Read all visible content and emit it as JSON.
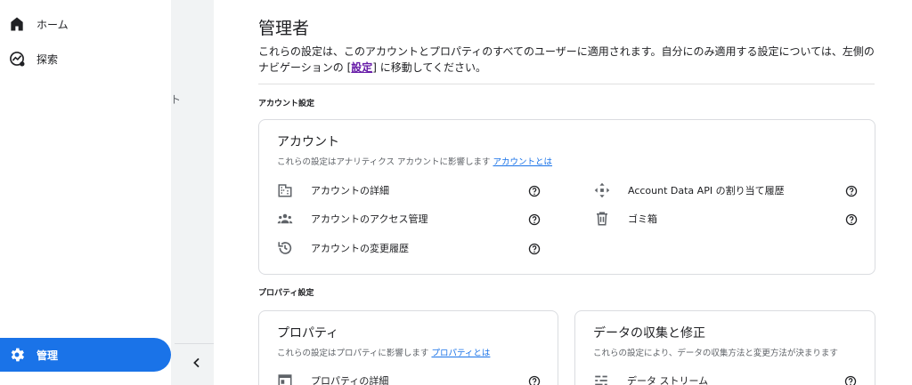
{
  "sidebar": {
    "items": [
      {
        "label": "ホーム",
        "icon": "home-icon"
      },
      {
        "label": "探索",
        "icon": "explore-icon"
      }
    ],
    "active_item": {
      "label": "管理",
      "icon": "gear-icon"
    }
  },
  "rail": {
    "glyph": "ト",
    "collapse_icon": "chevron-left-icon"
  },
  "header": {
    "title": "管理者",
    "desc_before": "これらの設定は、このアカウントとプロパティのすべてのユーザーに適用されます。自分にのみ適用する設定については、左側のナビゲーションの [",
    "desc_link": "設定",
    "desc_after": "] に移動してください。"
  },
  "sections": {
    "account_label": "アカウント設定",
    "property_label": "プロパティ設定"
  },
  "account_card": {
    "title": "アカウント",
    "subtitle": "これらの設定はアナリティクス アカウントに影響します",
    "link": "アカウントとは",
    "items": [
      {
        "label": "アカウントの詳細",
        "icon": "building-icon"
      },
      {
        "label": "アカウントのアクセス管理",
        "icon": "people-icon"
      },
      {
        "label": "アカウントの変更履歴",
        "icon": "history-icon"
      },
      {
        "label": "Account Data API の割り当て履歴",
        "icon": "move-arrows-icon"
      },
      {
        "label": "ゴミ箱",
        "icon": "trash-icon"
      }
    ]
  },
  "property_card": {
    "title": "プロパティ",
    "subtitle": "これらの設定はプロパティに影響します",
    "link": "プロパティとは",
    "items": [
      {
        "label": "プロパティの詳細",
        "icon": "browser-window-icon"
      }
    ]
  },
  "data_card": {
    "title": "データの収集と修正",
    "subtitle": "これらの設定により、データの収集方法と変更方法が決まります",
    "items": [
      {
        "label": "データ ストリーム",
        "icon": "stream-icon"
      }
    ]
  },
  "colors": {
    "accent": "#1a73e8",
    "link_visited": "#681da8",
    "icon_gray": "#5f6368"
  }
}
